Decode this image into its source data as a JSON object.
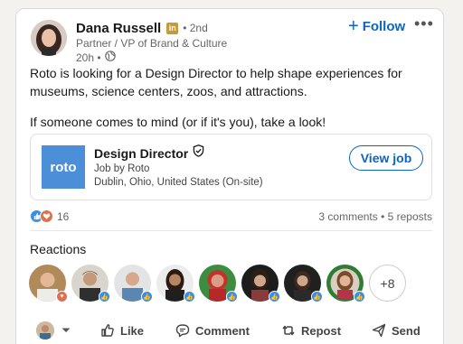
{
  "post": {
    "author": {
      "name": "Dana Russell",
      "premium_badge": "in",
      "degree": "• 2nd",
      "headline": "Partner / VP of Brand & Culture",
      "time": "20h •",
      "visibility_icon": "globe-icon"
    },
    "follow_label": "Follow",
    "follow_plus": "+",
    "more_label": "•••",
    "text": {
      "para1": "Roto is looking for a Design Director to help shape experiences for museums, science centers, zoos, and attractions.",
      "para2": "If someone comes to mind (or if it's you), take a look!"
    },
    "job": {
      "logo_text": "roto",
      "title": "Design Director",
      "company_line": "Job by Roto",
      "location": "Dublin, Ohio, United States (On-site)",
      "button": "View job",
      "verified_icon": "verified-shield-icon"
    },
    "social": {
      "reaction_count": "16",
      "counts_text": "3 comments • 5 reposts"
    },
    "reactions": {
      "title": "Reactions",
      "more_label": "+8",
      "people": [
        {
          "badge": "love"
        },
        {
          "badge": "like"
        },
        {
          "badge": "like"
        },
        {
          "badge": "like"
        },
        {
          "badge": "like"
        },
        {
          "badge": "like"
        },
        {
          "badge": "like"
        },
        {
          "badge": "like"
        }
      ]
    },
    "actions": {
      "like": "Like",
      "comment": "Comment",
      "repost": "Repost",
      "send": "Send"
    }
  },
  "colors": {
    "brand_blue": "#0a66c2",
    "like_blue": "#378fe9",
    "love_orange": "#df704d",
    "roto_blue": "#4a8fd8"
  }
}
